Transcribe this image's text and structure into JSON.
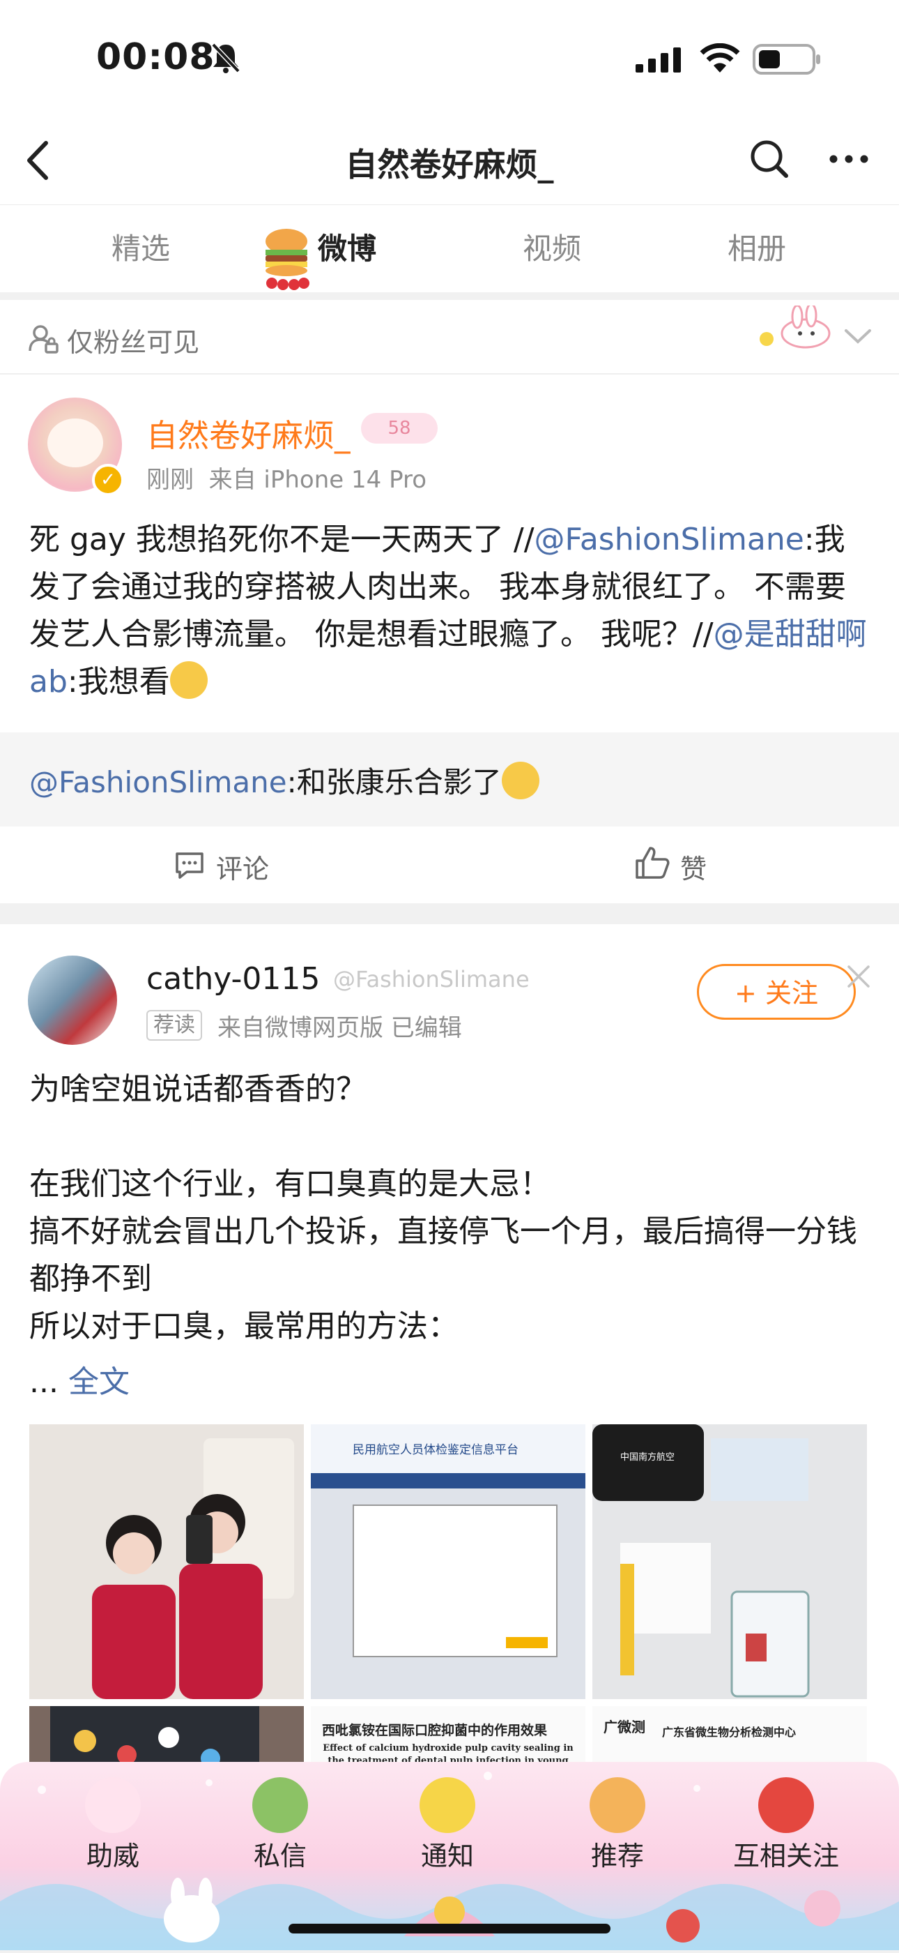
{
  "status_bar": {
    "time": "00:08",
    "icons": [
      "bell-slash-icon",
      "cellular-signal-icon",
      "wifi-icon",
      "battery-icon"
    ]
  },
  "nav": {
    "title": "自然卷好麻烦_",
    "icons": [
      "back-chevron-icon",
      "search-icon",
      "more-icon"
    ]
  },
  "tabs": [
    {
      "label": "精选",
      "active": false
    },
    {
      "label": "微博",
      "active": true
    },
    {
      "label": "视频",
      "active": false
    },
    {
      "label": "相册",
      "active": false
    }
  ],
  "post1": {
    "visibility": "仅粉丝可见",
    "author": "自然卷好麻烦_",
    "level_badge": "58",
    "time": "刚刚",
    "source": "来自 iPhone 14 Pro",
    "body": {
      "part1": "死 gay 我想掐死你不是一天两天了 //",
      "mention1": "@FashionSlimane",
      "part2": ":我发了会通过我的穿搭被人肉出来。 我本身就很红了。 不需要发艺人合影博流量。 你是想看过眼瘾了。 我呢？//",
      "mention2": "@是甜甜啊 ab",
      "part3": ":我想看"
    },
    "repost": {
      "mention": "@FashionSlimane",
      "text": ":和张康乐合影了"
    },
    "actions": {
      "comment": "评论",
      "like": "赞"
    }
  },
  "post2": {
    "author": "cathy-0115",
    "source_tag": "@FashionSlimane",
    "recommend_badge": "荐读",
    "meta": "来自微博网页版  已编辑",
    "follow_button": "+ 关注",
    "body": "为啥空姐说话都香香的？\n\n在我们这个行业，有口臭真的是大忌！\n搞不好就会冒出几个投诉，直接停飞一个月，最后搞得一分钱都挣不到\n所以对于口臭，最常用的方法：",
    "ellipsis": "... ",
    "full_text": "全文",
    "photo2_title": "民用航空人员体检鉴定信息平台",
    "photo5_title": "西吡氯铵在国际口腔抑菌中的作用效果",
    "photo5_subtitle": "Effect of calcium hydroxide pulp cavity sealing in the treatment of dental pulp infection in young permanent teeth",
    "photo6_brand": "广微测",
    "photo6_title": "广东省微生物分析检测中心",
    "photo3_brand": "中国南方航空"
  },
  "bottom_bar": {
    "items": [
      {
        "label": "助威",
        "icon": "bunny-icon"
      },
      {
        "label": "私信",
        "icon": "broccoli-icon"
      },
      {
        "label": "通知",
        "icon": "chick-icon"
      },
      {
        "label": "推荐",
        "icon": "pretzel-icon"
      },
      {
        "label": "互相关注",
        "icon": "tomato-icon"
      }
    ]
  },
  "colors": {
    "accent_orange": "#ff7a1a",
    "link_blue": "#4b6ea9",
    "meta_gray": "#8f8f8f"
  }
}
